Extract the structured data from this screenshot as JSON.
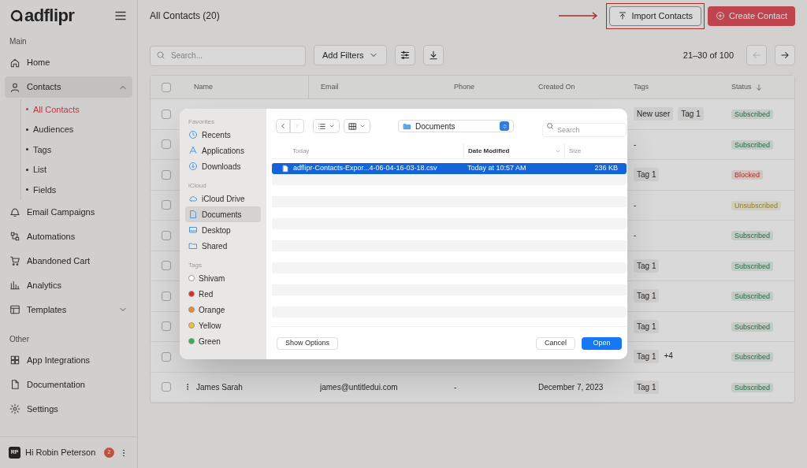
{
  "sidebar": {
    "logo": "adflipr",
    "sections": [
      {
        "title": "Main",
        "items": [
          {
            "label": "Home",
            "selected": false
          },
          {
            "label": "Contacts",
            "selected": true,
            "expanded": true,
            "children": [
              {
                "label": "All Contacts",
                "selected": true
              },
              {
                "label": "Audiences",
                "selected": false
              },
              {
                "label": "Tags",
                "selected": false
              },
              {
                "label": "List",
                "selected": false
              },
              {
                "label": "Fields",
                "selected": false
              }
            ]
          },
          {
            "label": "Email Campaigns",
            "selected": false
          },
          {
            "label": "Automations",
            "selected": false
          },
          {
            "label": "Abandoned Cart",
            "selected": false
          },
          {
            "label": "Analytics",
            "selected": false
          },
          {
            "label": "Templates",
            "selected": false,
            "expanded": false
          }
        ]
      },
      {
        "title": "Other",
        "items": [
          {
            "label": "App Integrations",
            "selected": false
          },
          {
            "label": "Documentation",
            "selected": false
          },
          {
            "label": "Settings",
            "selected": false
          }
        ]
      }
    ],
    "user": {
      "initials": "RP",
      "greeting": "Hi Robin Peterson",
      "badge": "2"
    }
  },
  "header": {
    "title": "All Contacts (20)",
    "import_button": "Import Contacts",
    "create_button": "Create Contact"
  },
  "toolbar": {
    "search": {
      "placeholder": "Search..."
    },
    "filters_button": "Add Filters",
    "pagination": "21–30 of 100",
    "prev_disabled": true
  },
  "table": {
    "columns": [
      "Name",
      "Email",
      "Phone",
      "Created On",
      "Tags",
      "Status"
    ],
    "select_all_checked": false,
    "rows": [
      {
        "checked": false,
        "tags": [
          "New user",
          "Tag 1"
        ],
        "status": "Subscribed",
        "kind": "subscribed"
      },
      {
        "checked": false,
        "tags": [
          "-"
        ],
        "status": "Subscribed",
        "kind": "subscribed"
      },
      {
        "checked": false,
        "tags": [
          "Tag 1"
        ],
        "status": "Blocked",
        "kind": "blocked"
      },
      {
        "checked": false,
        "tags": [
          "-"
        ],
        "status": "Unsubscribed",
        "kind": "unsubscribed"
      },
      {
        "checked": false,
        "tags": [
          "-"
        ],
        "status": "Subscribed",
        "kind": "subscribed"
      },
      {
        "checked": false,
        "tags": [
          "Tag 1"
        ],
        "status": "Subscribed",
        "kind": "subscribed"
      },
      {
        "checked": false,
        "tags": [
          "Tag 1"
        ],
        "status": "Subscribed",
        "kind": "subscribed"
      },
      {
        "checked": false,
        "tags": [
          "Tag 1"
        ],
        "status": "Subscribed",
        "kind": "subscribed"
      },
      {
        "checked": false,
        "tags": [
          "Tag 1",
          "+4"
        ],
        "status": "Subscribed",
        "kind": "subscribed"
      },
      {
        "checked": false,
        "name": "James Sarah",
        "email": "james@untitledui.com",
        "phone": "-",
        "created_on": "December 7, 2023",
        "tags": [
          "Tag 1"
        ],
        "status": "Subscribed",
        "kind": "subscribed"
      }
    ]
  },
  "file_dialog": {
    "sidebar": [
      {
        "title": "Favorites",
        "items": [
          {
            "label": "Recents",
            "selected": false
          },
          {
            "label": "Applications",
            "selected": false
          },
          {
            "label": "Downloads",
            "selected": false
          }
        ]
      },
      {
        "title": "iCloud",
        "items": [
          {
            "label": "iCloud Drive",
            "selected": false
          },
          {
            "label": "Documents",
            "selected": true
          },
          {
            "label": "Desktop",
            "selected": false
          },
          {
            "label": "Shared",
            "selected": false
          }
        ]
      },
      {
        "title": "Tags",
        "items": [
          {
            "label": "Shivam",
            "selected": false,
            "color": "#ffffff"
          },
          {
            "label": "Red",
            "selected": false,
            "color": "#e3261f"
          },
          {
            "label": "Orange",
            "selected": false,
            "color": "#f08a24"
          },
          {
            "label": "Yellow",
            "selected": false,
            "color": "#f2c12e"
          },
          {
            "label": "Green",
            "selected": false,
            "color": "#2fb34a"
          }
        ]
      }
    ],
    "location": "Documents",
    "search": {
      "placeholder": "Search"
    },
    "columns": [
      "Today",
      "Date Modified",
      "Size"
    ],
    "files": [
      {
        "name": "adflipr-Contacts-Expor...4-06-04-16-03-18.csv",
        "date": "Today at 10:57 AM",
        "size": "236 KB",
        "selected": true
      }
    ],
    "buttons": {
      "options": "Show Options",
      "cancel": "Cancel",
      "open": "Open"
    }
  }
}
